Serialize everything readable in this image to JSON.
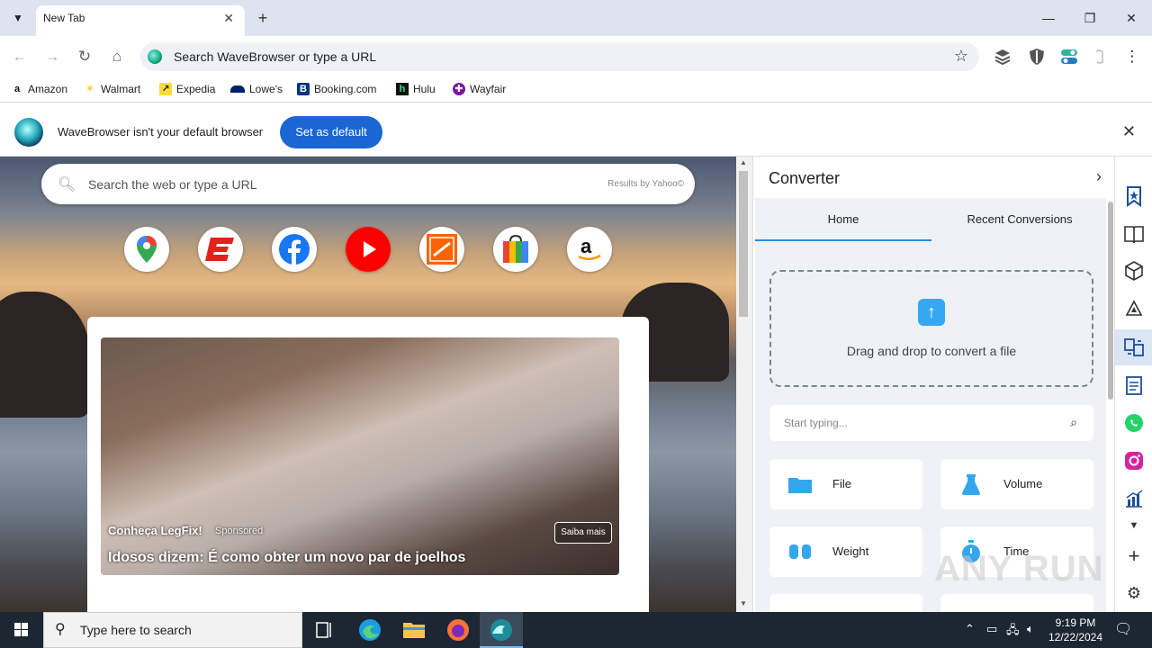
{
  "tab": {
    "title": "New Tab"
  },
  "window_controls": {
    "minimize": "—",
    "restore": "❐",
    "close": "✕"
  },
  "omnibox": {
    "placeholder": "Search WaveBrowser or type a URL"
  },
  "bookmarks": [
    {
      "label": "Amazon",
      "icon": "amazon-icon"
    },
    {
      "label": "Walmart",
      "icon": "walmart-icon"
    },
    {
      "label": "Expedia",
      "icon": "expedia-icon"
    },
    {
      "label": "Lowe's",
      "icon": "lowes-icon"
    },
    {
      "label": "Booking.com",
      "icon": "booking-icon"
    },
    {
      "label": "Hulu",
      "icon": "hulu-icon"
    },
    {
      "label": "Wayfair",
      "icon": "wayfair-icon"
    }
  ],
  "infobar": {
    "message": "WaveBrowser isn't your default browser",
    "button": "Set as default"
  },
  "newtab": {
    "search_placeholder": "Search the web or type a URL",
    "search_provider": "Results by Yahoo©",
    "tiles": [
      "google-maps-icon",
      "espn-icon",
      "facebook-icon",
      "youtube-icon",
      "home-depot-icon",
      "shopping-icon",
      "amazon-icon"
    ]
  },
  "ad": {
    "brand": "Conheça LegFix!",
    "sponsored": "Sponsored",
    "cta": "Saiba mais",
    "headline": "Idosos dizem: É como obter um novo par de joelhos"
  },
  "converter": {
    "title": "Converter",
    "tabs": [
      "Home",
      "Recent Conversions"
    ],
    "drop_text": "Drag and drop to convert a file",
    "search_placeholder": "Start typing...",
    "categories": [
      "File",
      "Volume",
      "Weight",
      "Time"
    ]
  },
  "taskbar": {
    "search_placeholder": "Type here to search",
    "time": "9:19 PM",
    "date": "12/22/2024"
  },
  "watermark": "ANY RUN",
  "colors": {
    "accent": "#1a66d2",
    "tab_underline": "#2b8bd8",
    "taskbar": "#1c2733"
  }
}
